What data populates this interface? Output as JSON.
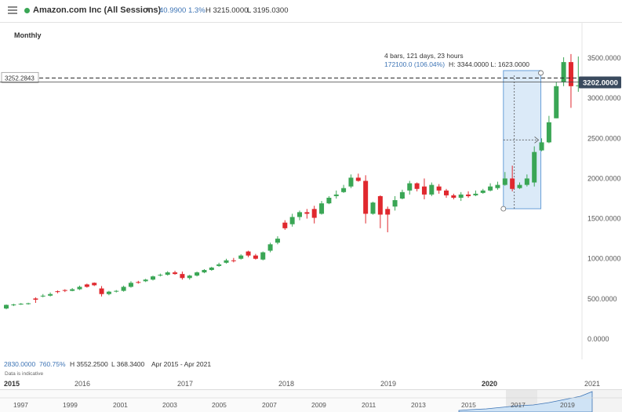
{
  "header": {
    "instrument": "Amazon.com Inc (All Sessions)",
    "change": "40.9900",
    "change_pct": "1.3%",
    "high": "H 3215.0000",
    "low": "L 3195.0300"
  },
  "timeframe": "Monthly",
  "footer": {
    "change": "2830.0000",
    "change_pct": "760.75%",
    "high": "H 3552.2500",
    "low": "L 368.3400",
    "range": "Apr 2015 - Apr 2021",
    "note": "Data is indicative"
  },
  "timeline": {
    "years": [
      "2015",
      "2016",
      "2017",
      "2018",
      "2019",
      "2020",
      "2021"
    ]
  },
  "navigator": {
    "years": [
      "1997",
      "1999",
      "2001",
      "2003",
      "2005",
      "2007",
      "2009",
      "2011",
      "2013",
      "2015",
      "2017",
      "2019"
    ]
  },
  "colors": {
    "up": "#3aa655",
    "down": "#e0282e",
    "accent": "#3d74b5",
    "measure_fill": "#cfe3f5"
  },
  "chart_data": {
    "type": "candlestick",
    "title": "Amazon.com Inc (All Sessions)",
    "ylim": [
      0,
      3650
    ],
    "yticks": [
      0,
      500,
      1000,
      1500,
      2000,
      2500,
      3000,
      3500
    ],
    "ytick_labels": [
      "0.0000",
      "500.0000",
      "1000.0000",
      "1500.0000",
      "2000.0000",
      "2500.0000",
      "3000.0000",
      "3500.0000"
    ],
    "current_price": 3202,
    "current_price_label": "3202.0000",
    "crosshair_price": 3252.2843,
    "crosshair_price_label": "3252.2843",
    "measure": {
      "line1": "4 bars, 121 days, 23 hours",
      "line2a": "172100.0 (106.04%)",
      "line2b": "H: 3344.0000 L: 1623.0000",
      "high": 3344,
      "low": 1623
    },
    "candles": [
      [
        380,
        425,
        370,
        430
      ],
      [
        425,
        430,
        410,
        440
      ],
      [
        430,
        440,
        425,
        448
      ],
      [
        435,
        445,
        428,
        452
      ],
      [
        505,
        490,
        450,
        520
      ],
      [
        530,
        540,
        520,
        560
      ],
      [
        540,
        560,
        530,
        580
      ],
      [
        595,
        585,
        570,
        605
      ],
      [
        610,
        600,
        585,
        620
      ],
      [
        600,
        620,
        595,
        635
      ],
      [
        620,
        650,
        610,
        665
      ],
      [
        680,
        650,
        640,
        690
      ],
      [
        700,
        670,
        660,
        705
      ],
      [
        630,
        560,
        530,
        660
      ],
      [
        560,
        590,
        545,
        600
      ],
      [
        590,
        600,
        580,
        610
      ],
      [
        600,
        650,
        590,
        665
      ],
      [
        650,
        700,
        640,
        720
      ],
      [
        710,
        700,
        690,
        725
      ],
      [
        720,
        740,
        710,
        750
      ],
      [
        740,
        780,
        730,
        790
      ],
      [
        790,
        800,
        780,
        815
      ],
      [
        800,
        830,
        790,
        845
      ],
      [
        830,
        810,
        800,
        850
      ],
      [
        810,
        760,
        740,
        840
      ],
      [
        760,
        790,
        740,
        800
      ],
      [
        790,
        830,
        780,
        840
      ],
      [
        830,
        860,
        820,
        870
      ],
      [
        860,
        890,
        850,
        900
      ],
      [
        910,
        930,
        900,
        950
      ],
      [
        950,
        980,
        940,
        1000
      ],
      [
        980,
        970,
        955,
        1010
      ],
      [
        1000,
        1040,
        990,
        1055
      ],
      [
        1090,
        1040,
        1020,
        1100
      ],
      [
        1040,
        1000,
        990,
        1060
      ],
      [
        990,
        1080,
        980,
        1090
      ],
      [
        1100,
        1180,
        1080,
        1200
      ],
      [
        1200,
        1250,
        1180,
        1280
      ],
      [
        1450,
        1380,
        1360,
        1480
      ],
      [
        1430,
        1520,
        1400,
        1560
      ],
      [
        1520,
        1580,
        1480,
        1600
      ],
      [
        1580,
        1560,
        1500,
        1620
      ],
      [
        1620,
        1510,
        1440,
        1660
      ],
      [
        1560,
        1690,
        1550,
        1720
      ],
      [
        1690,
        1760,
        1680,
        1780
      ],
      [
        1780,
        1800,
        1750,
        1850
      ],
      [
        1830,
        1880,
        1820,
        1920
      ],
      [
        1900,
        2010,
        1880,
        2050
      ],
      [
        2010,
        1970,
        1960,
        2060
      ],
      [
        1970,
        1560,
        1440,
        2040
      ],
      [
        1560,
        1700,
        1550,
        1710
      ],
      [
        1780,
        1550,
        1380,
        1790
      ],
      [
        1620,
        1550,
        1330,
        1650
      ],
      [
        1650,
        1730,
        1600,
        1780
      ],
      [
        1750,
        1830,
        1740,
        1860
      ],
      [
        1850,
        1940,
        1800,
        1970
      ],
      [
        1940,
        1870,
        1840,
        1950
      ],
      [
        1900,
        1800,
        1740,
        2000
      ],
      [
        1800,
        1920,
        1780,
        1950
      ],
      [
        1900,
        1850,
        1810,
        1930
      ],
      [
        1850,
        1790,
        1760,
        1870
      ],
      [
        1790,
        1760,
        1740,
        1810
      ],
      [
        1760,
        1800,
        1720,
        1830
      ],
      [
        1800,
        1780,
        1760,
        1840
      ],
      [
        1790,
        1810,
        1780,
        1850
      ],
      [
        1820,
        1850,
        1810,
        1870
      ],
      [
        1850,
        1900,
        1840,
        1940
      ],
      [
        1880,
        1920,
        1860,
        1960
      ],
      [
        1920,
        2000,
        1910,
        2080
      ],
      [
        2000,
        1870,
        1840,
        2160
      ],
      [
        1880,
        1920,
        1870,
        1950
      ],
      [
        1920,
        2000,
        1900,
        2050
      ],
      [
        1950,
        2330,
        1900,
        2400
      ],
      [
        2350,
        2450,
        2340,
        2500
      ],
      [
        2450,
        2700,
        2440,
        2780
      ],
      [
        2750,
        3150,
        2750,
        3200
      ],
      [
        3200,
        3450,
        3150,
        3510
      ],
      [
        3450,
        3150,
        2880,
        3550
      ],
      [
        3150,
        3160,
        3080,
        3520
      ]
    ]
  }
}
